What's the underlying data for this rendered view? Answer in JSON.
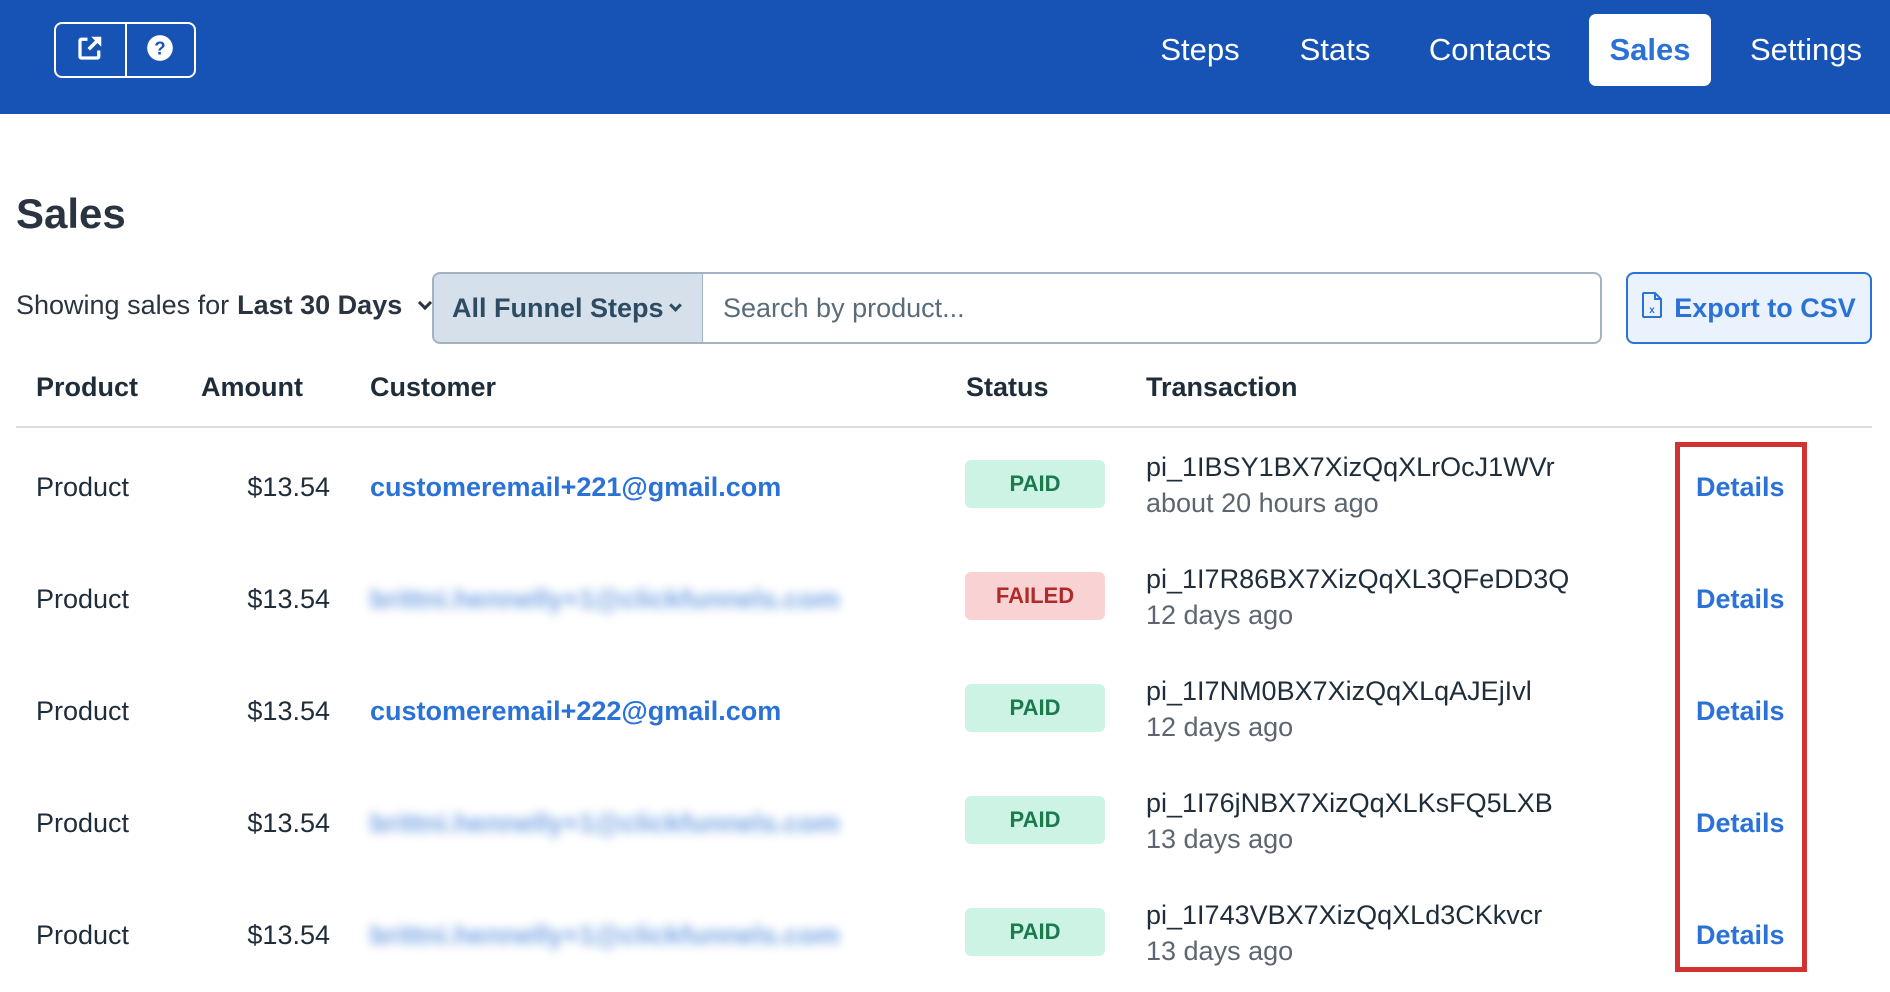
{
  "topbar": {
    "icon_buttons": [
      {
        "icon": "external-link-icon"
      },
      {
        "icon": "help-icon"
      }
    ],
    "nav": [
      {
        "label": "Steps",
        "active": false
      },
      {
        "label": "Stats",
        "active": false
      },
      {
        "label": "Contacts",
        "active": false
      },
      {
        "label": "Sales",
        "active": true
      },
      {
        "label": "Settings",
        "active": false
      }
    ]
  },
  "page": {
    "title": "Sales",
    "filter_prefix": "Showing sales for",
    "filter_period": "Last 30 Days",
    "funnel_select": "All Funnel Steps",
    "search_placeholder": "Search by product...",
    "search_value": "",
    "export_label": "Export to CSV"
  },
  "table": {
    "headers": [
      "Product",
      "Amount",
      "Customer",
      "Status",
      "Transaction"
    ],
    "rows": [
      {
        "product": "Product",
        "amount": "$13.54",
        "customer": "customeremail+221@gmail.com",
        "customer_blurred": false,
        "status": "PAID",
        "transaction_id": "pi_1IBSY1BX7XizQqXLrOcJ1WVr",
        "time": "about 20 hours ago",
        "action": "Details"
      },
      {
        "product": "Product",
        "amount": "$13.54",
        "customer": "brittni.hennelly+1@clickfunnels.com",
        "customer_blurred": true,
        "status": "FAILED",
        "transaction_id": "pi_1I7R86BX7XizQqXL3QFeDD3Q",
        "time": "12 days ago",
        "action": "Details"
      },
      {
        "product": "Product",
        "amount": "$13.54",
        "customer": "customeremail+222@gmail.com",
        "customer_blurred": false,
        "status": "PAID",
        "transaction_id": "pi_1I7NM0BX7XizQqXLqAJEjIvl",
        "time": "12 days ago",
        "action": "Details"
      },
      {
        "product": "Product",
        "amount": "$13.54",
        "customer": "brittni.hennelly+1@clickfunnels.com",
        "customer_blurred": true,
        "status": "PAID",
        "transaction_id": "pi_1I76jNBX7XizQqXLKsFQ5LXB",
        "time": "13 days ago",
        "action": "Details"
      },
      {
        "product": "Product",
        "amount": "$13.54",
        "customer": "brittni.hennelly+1@clickfunnels.com",
        "customer_blurred": true,
        "status": "PAID",
        "transaction_id": "pi_1I743VBX7XizQqXLd3CKkvcr",
        "time": "13 days ago",
        "action": "Details"
      }
    ]
  },
  "colors": {
    "brand": "#1753b5",
    "link": "#2a72d6",
    "paid_bg": "#ccf3e3",
    "failed_bg": "#f9d3d3",
    "highlight": "#d33232"
  }
}
